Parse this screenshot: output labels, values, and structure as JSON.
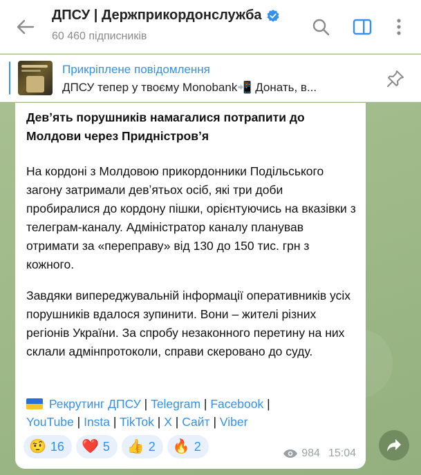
{
  "header": {
    "title": "ДПСУ | Держприкордонслужба",
    "subscribers": "60 460 підписників"
  },
  "pinned": {
    "label": "Прикріплене повідомлення",
    "text": "ДПСУ тепер у твоєму Monobank📲 Донать, в..."
  },
  "message": {
    "title": "Девʼять порушників намагалися потрапити до Молдови через Придністровʼя",
    "paragraph1": "На кордоні з Молдовою прикордонники Подільського загону затримали девʼятьох осіб, які три доби пробиралися до кордону пішки, орієнтуючись на вказівки з телеграм-каналу. Адміністратор каналу планував отримати за «переправу» від 130 до 150 тис. грн з кожного.",
    "paragraph2": "Завдяки випереджувальній інформації оперативників усіх порушників вдалося зупинити. Вони – жителі різних регіонів України. За спробу незаконного перетину на них склали адмінпротоколи, справи скеровано до суду.",
    "links": [
      "Рекрутинг ДПСУ",
      "Telegram",
      "Facebook",
      "YouTube",
      "Insta",
      "TikTok",
      "X",
      "Сайт",
      "Viber"
    ],
    "reactions": [
      {
        "emoji": "🤨",
        "count": "16"
      },
      {
        "emoji": "❤️",
        "count": "5"
      },
      {
        "emoji": "👍",
        "count": "2"
      },
      {
        "emoji": "🔥",
        "count": "2"
      }
    ],
    "views": "984",
    "time": "15:04"
  },
  "colors": {
    "accent": "#3390ec",
    "background": "#9fb88a"
  }
}
